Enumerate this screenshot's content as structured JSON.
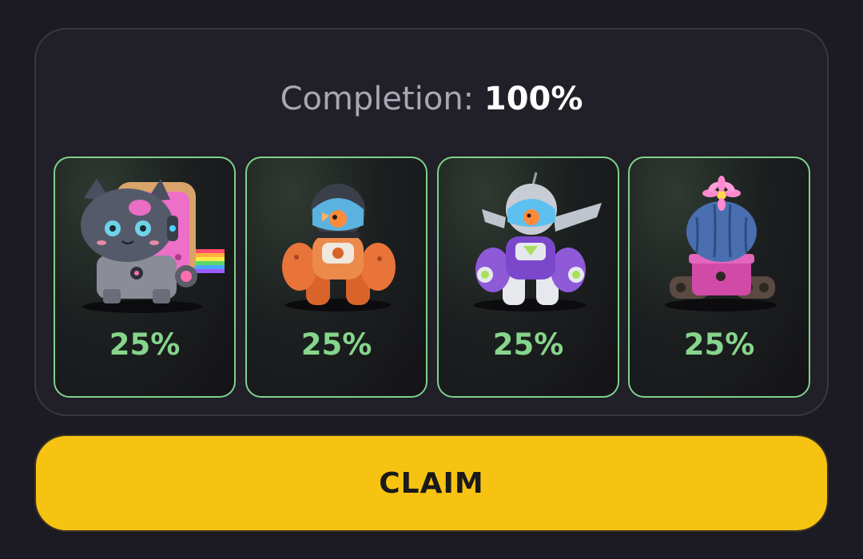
{
  "completion": {
    "label": "Completion:",
    "value": "100%"
  },
  "cards": [
    {
      "icon": "robot-cat-icon",
      "percent": "25%"
    },
    {
      "icon": "orange-diver-robot-icon",
      "percent": "25%"
    },
    {
      "icon": "purple-astronaut-robot-icon",
      "percent": "25%"
    },
    {
      "icon": "cactus-tank-robot-icon",
      "percent": "25%"
    }
  ],
  "claim_button": {
    "label": "CLAIM"
  },
  "colors": {
    "background": "#1c1a22",
    "panel_border": "#3a3743",
    "card_border": "#7ed28a",
    "percent_text": "#86d58c",
    "claim_button": "#f7c312"
  }
}
